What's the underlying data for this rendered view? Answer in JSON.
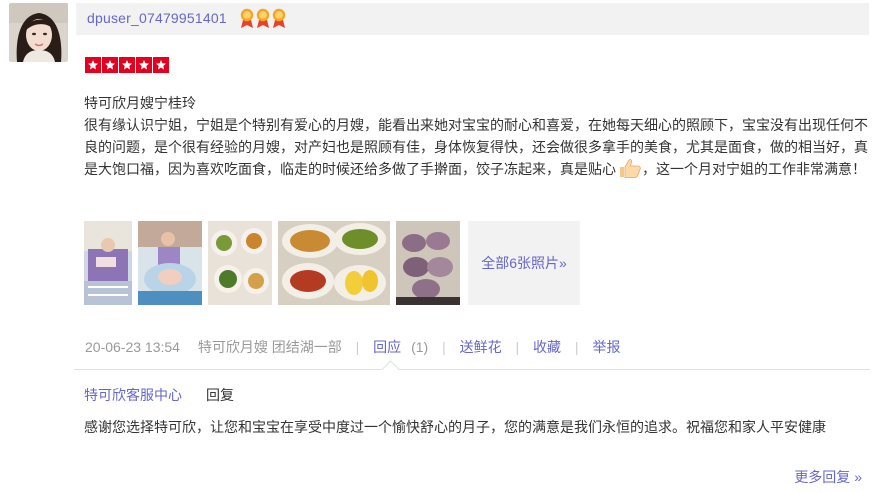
{
  "reviewer": {
    "username": "dpuser_07479951401",
    "avatar_icon": "user-avatar",
    "medal_icon": "medal-icon",
    "medal_count": 3
  },
  "rating": {
    "stars": 5,
    "max": 5,
    "color": "#e4001f"
  },
  "review": {
    "title": "特可欣月嫂宁桂玲",
    "body_part1": "很有缘认识宁姐，宁姐是个特别有爱心的月嫂，能看出来她对宝宝的耐心和喜爱，在她每天细心的照顾下，宝宝没有出现任何不良的问题，是个很有经验的月嫂，对产妇也是照顾有佳，身体恢复得快，还会做很多拿手的美食，尤其是面食，做的相当好，真是大饱口福，因为喜欢吃面食，临走的时候还给多做了手擀面，饺子冻起来，真是贴心",
    "body_part2": "，这一个月对宁姐的工作非常满意！",
    "emoji_icon": "thumbs-up-icon"
  },
  "photos": {
    "all_label": "全部6张照片»"
  },
  "meta": {
    "date": "20-06-23 13:54",
    "shop": "特可欣月嫂 团结湖一部",
    "reply_label": "回应",
    "reply_count": "(1)",
    "flower_label": "送鲜花",
    "favorite_label": "收藏",
    "report_label": "举报",
    "separator": "|"
  },
  "merchant_reply": {
    "author": "特可欣客服中心",
    "tag": "回复",
    "text": "感谢您选择特可欣，让您和宝宝在享受中度过一个愉快舒心的月子，您的满意是我们永恒的追求。祝福您和家人平安健康",
    "more_label": "更多回复 »"
  },
  "colors": {
    "link": "#6666cc",
    "muted": "#999999",
    "text": "#333333",
    "header_bg": "#f2f2f2"
  }
}
